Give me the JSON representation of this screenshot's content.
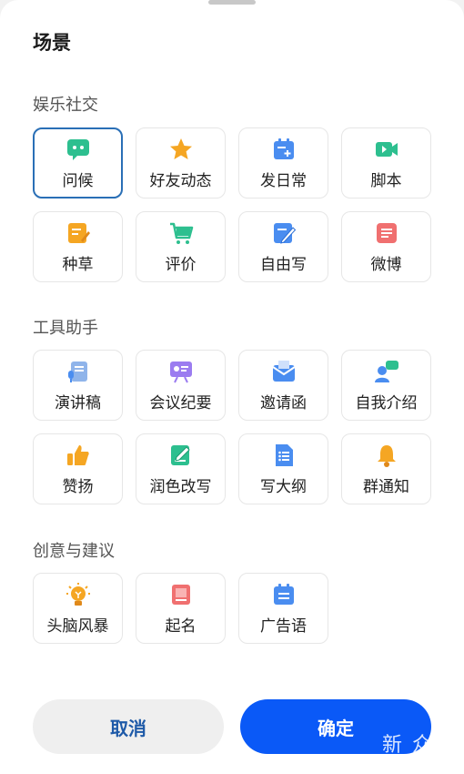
{
  "title": "场景",
  "sections": [
    {
      "label": "娱乐社交",
      "items": [
        {
          "label": "问候",
          "icon": "chat-bubble-icon"
        },
        {
          "label": "好友动态",
          "icon": "star-icon"
        },
        {
          "label": "发日常",
          "icon": "calendar-add-icon"
        },
        {
          "label": "脚本",
          "icon": "video-camera-icon"
        },
        {
          "label": "种草",
          "icon": "note-edit-icon"
        },
        {
          "label": "评价",
          "icon": "shopping-cart-icon"
        },
        {
          "label": "自由写",
          "icon": "pen-paper-icon"
        },
        {
          "label": "微博",
          "icon": "document-lines-icon"
        }
      ]
    },
    {
      "label": "工具助手",
      "items": [
        {
          "label": "演讲稿",
          "icon": "scroll-mic-icon"
        },
        {
          "label": "会议纪要",
          "icon": "presentation-board-icon"
        },
        {
          "label": "邀请函",
          "icon": "envelope-icon"
        },
        {
          "label": "自我介绍",
          "icon": "person-speech-icon"
        },
        {
          "label": "赞扬",
          "icon": "thumbs-up-icon"
        },
        {
          "label": "润色改写",
          "icon": "edit-square-icon"
        },
        {
          "label": "写大纲",
          "icon": "outline-doc-icon"
        },
        {
          "label": "群通知",
          "icon": "bell-icon"
        }
      ]
    },
    {
      "label": "创意与建议",
      "items": [
        {
          "label": "头脑风暴",
          "icon": "lightbulb-icon"
        },
        {
          "label": "起名",
          "icon": "name-card-icon"
        },
        {
          "label": "广告语",
          "icon": "calendar-note-icon"
        }
      ]
    }
  ],
  "buttons": {
    "cancel": "取消",
    "confirm": "确定"
  },
  "watermark": "新 众测",
  "colors": {
    "accent": "#0a59f7",
    "selected_border": "#2a6fb6"
  }
}
